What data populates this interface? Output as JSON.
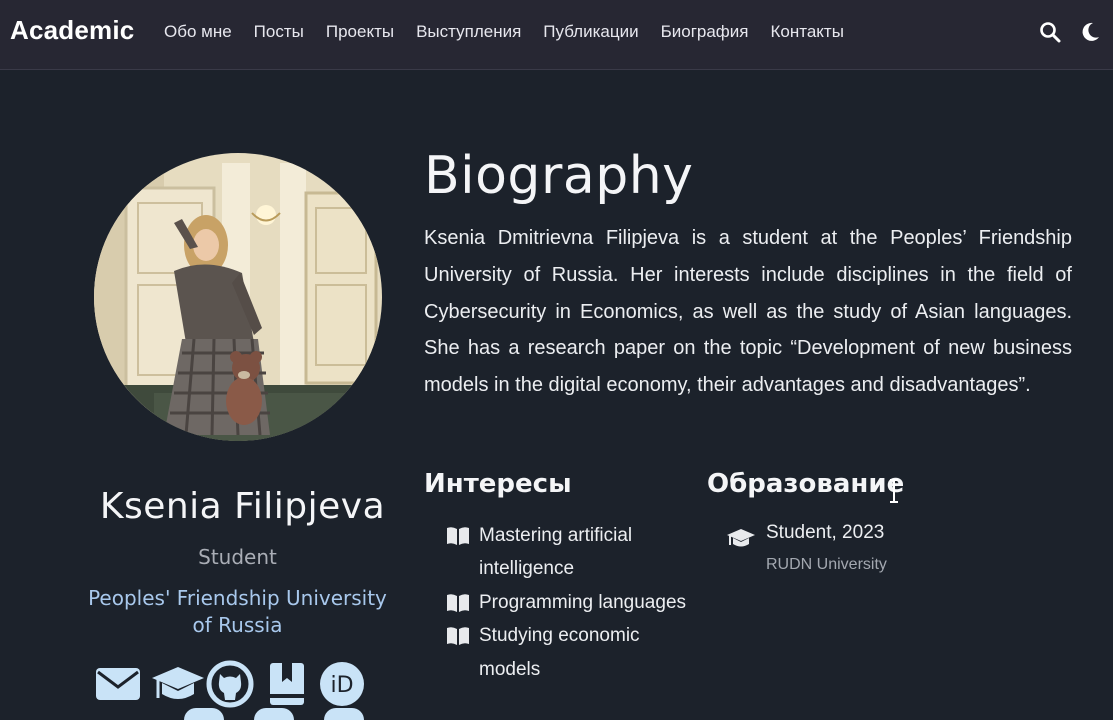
{
  "navbar": {
    "brand": "Academic",
    "links": [
      "Обо мне",
      "Посты",
      "Проекты",
      "Выступления",
      "Публикации",
      "Биография",
      "Контакты"
    ],
    "icons": [
      "search-icon",
      "moon-icon"
    ]
  },
  "profile": {
    "name": "Ksenia Filipjeva",
    "role": "Student",
    "organization": "Peoples' Friendship University of Russia",
    "social_icons": [
      "envelope-icon",
      "graduation-cap-icon",
      "github-icon",
      "book-bookmark-icon",
      "orcid-icon"
    ]
  },
  "biography": {
    "title": "Biography",
    "text": "Ksenia Dmitrievna Filipjeva is a student at the Peoples’ Friendship University of Russia. Her interests include disciplines in the field of Cybersecurity in Economics, as well as the study of Asian languages. She has a research paper on the topic “Development of new business models in the digital economy, their advantages and disadvantages”."
  },
  "interests": {
    "title": "Интересы",
    "items": [
      "Mastering artificial intelligence",
      "Programming languages",
      "Studying economic models"
    ]
  },
  "education": {
    "title": "Образование",
    "items": [
      {
        "degree": "Student, 2023",
        "school": "RUDN University"
      }
    ]
  },
  "colors": {
    "background": "#1c222b",
    "navbar": "#272733",
    "accent_link": "#a8c8ec",
    "social_icon": "#c9e3f7"
  }
}
